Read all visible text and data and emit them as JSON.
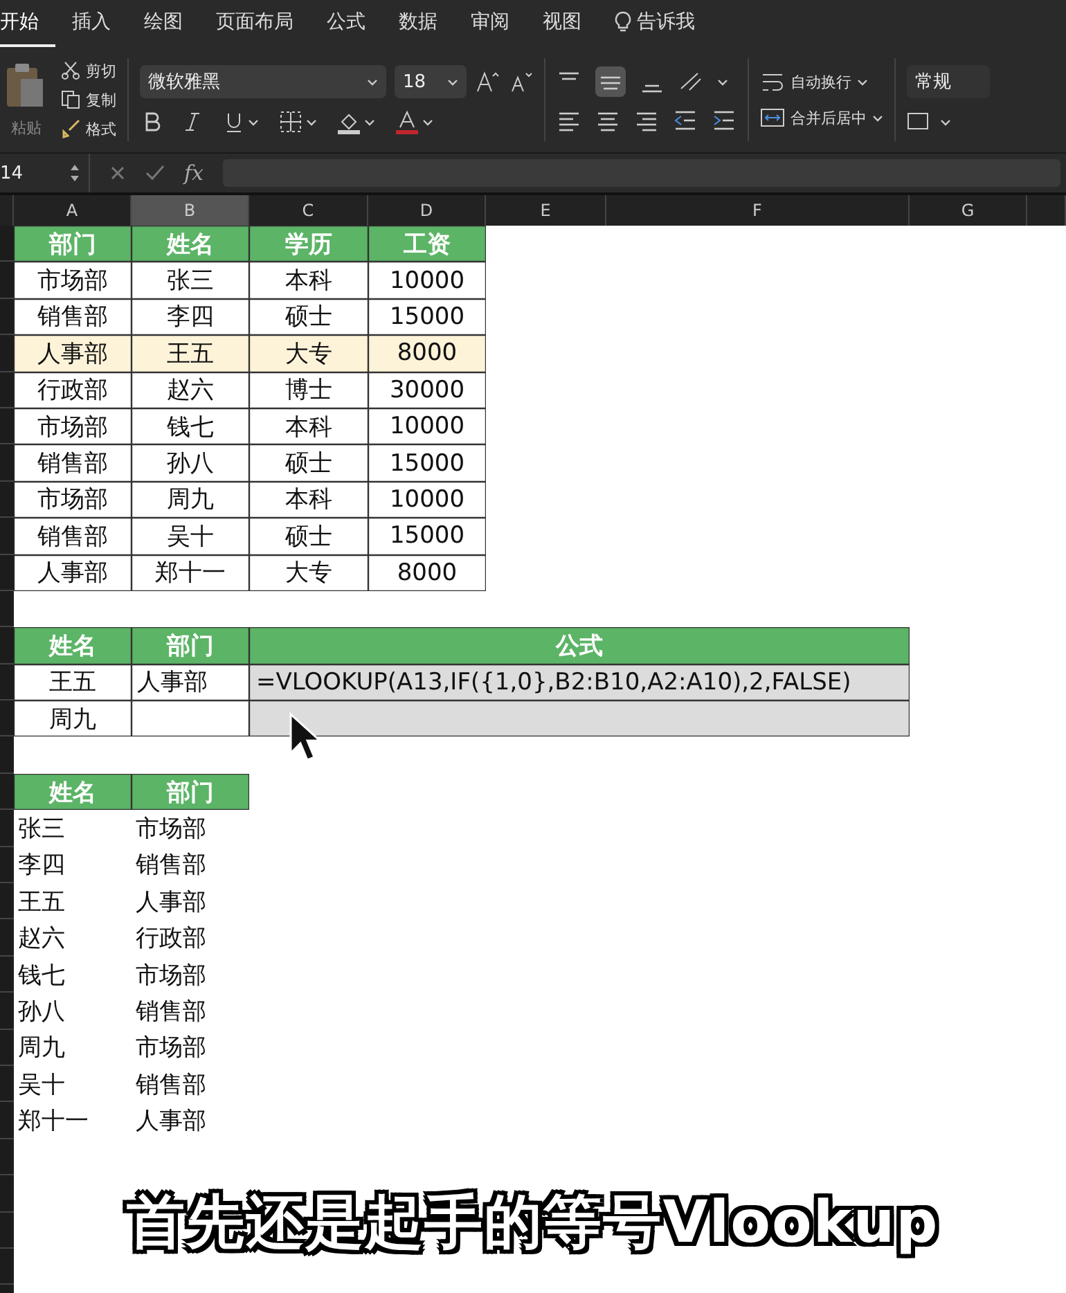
{
  "tabs": [
    {
      "label": "开始",
      "selected": true,
      "kind": "tab"
    },
    {
      "label": "插入",
      "selected": false,
      "kind": "tab"
    },
    {
      "label": "绘图",
      "selected": false,
      "kind": "tab"
    },
    {
      "label": "页面布局",
      "selected": false,
      "kind": "tab"
    },
    {
      "label": "公式",
      "selected": false,
      "kind": "tab"
    },
    {
      "label": "数据",
      "selected": false,
      "kind": "tab"
    },
    {
      "label": "审阅",
      "selected": false,
      "kind": "tab"
    },
    {
      "label": "视图",
      "selected": false,
      "kind": "tab"
    },
    {
      "label": "告诉我",
      "selected": false,
      "kind": "tell"
    }
  ],
  "clipboard": {
    "paste": "粘贴",
    "cut": "剪切",
    "copy": "复制",
    "format": "格式"
  },
  "font": {
    "name": "微软雅黑",
    "size": "18"
  },
  "wrap": "自动换行",
  "merge": "合并后居中",
  "number_format": "常规",
  "formula_bar": {
    "name_box": "14",
    "fx": "fx"
  },
  "columns": [
    {
      "label": "A",
      "selected": false
    },
    {
      "label": "B",
      "selected": true
    },
    {
      "label": "C",
      "selected": false
    },
    {
      "label": "D",
      "selected": false
    },
    {
      "label": "E",
      "selected": false
    },
    {
      "label": "F",
      "selected": false
    },
    {
      "label": "G",
      "selected": false
    }
  ],
  "table": {
    "columns": [
      "部门",
      "姓名",
      "学历",
      "工资"
    ],
    "rows": [
      {
        "cells": [
          "市场部",
          "张三",
          "本科",
          "10000"
        ],
        "highlighted": false
      },
      {
        "cells": [
          "销售部",
          "李四",
          "硕士",
          "15000"
        ],
        "highlighted": false
      },
      {
        "cells": [
          "人事部",
          "王五",
          "大专",
          "8000"
        ],
        "highlighted": true
      },
      {
        "cells": [
          "行政部",
          "赵六",
          "博士",
          "30000"
        ],
        "highlighted": false
      },
      {
        "cells": [
          "市场部",
          "钱七",
          "本科",
          "10000"
        ],
        "highlighted": false
      },
      {
        "cells": [
          "销售部",
          "孙八",
          "硕士",
          "15000"
        ],
        "highlighted": false
      },
      {
        "cells": [
          "市场部",
          "周九",
          "本科",
          "10000"
        ],
        "highlighted": false
      },
      {
        "cells": [
          "销售部",
          "吴十",
          "硕士",
          "15000"
        ],
        "highlighted": false
      },
      {
        "cells": [
          "人事部",
          "郑十一",
          "大专",
          "8000"
        ],
        "highlighted": false
      }
    ]
  },
  "lookup": {
    "columns": [
      "姓名",
      "部门",
      "公式"
    ],
    "rows": [
      {
        "name": "王五",
        "dept": "人事部",
        "formula": "=VLOOKUP(A13,IF({1,0},B2:B10,A2:A10),2,FALSE)"
      },
      {
        "name": "周九"
      }
    ]
  },
  "list": {
    "columns": [
      "姓名",
      "部门"
    ],
    "rows": [
      [
        "张三",
        "市场部"
      ],
      [
        "李四",
        "销售部"
      ],
      [
        "王五",
        "人事部"
      ],
      [
        "赵六",
        "行政部"
      ],
      [
        "钱七",
        "市场部"
      ],
      [
        "孙八",
        "销售部"
      ],
      [
        "周九",
        "市场部"
      ],
      [
        "吴十",
        "销售部"
      ],
      [
        "郑十一",
        "人事部"
      ]
    ]
  },
  "caption": "首先还是起手的等号Vlookup"
}
